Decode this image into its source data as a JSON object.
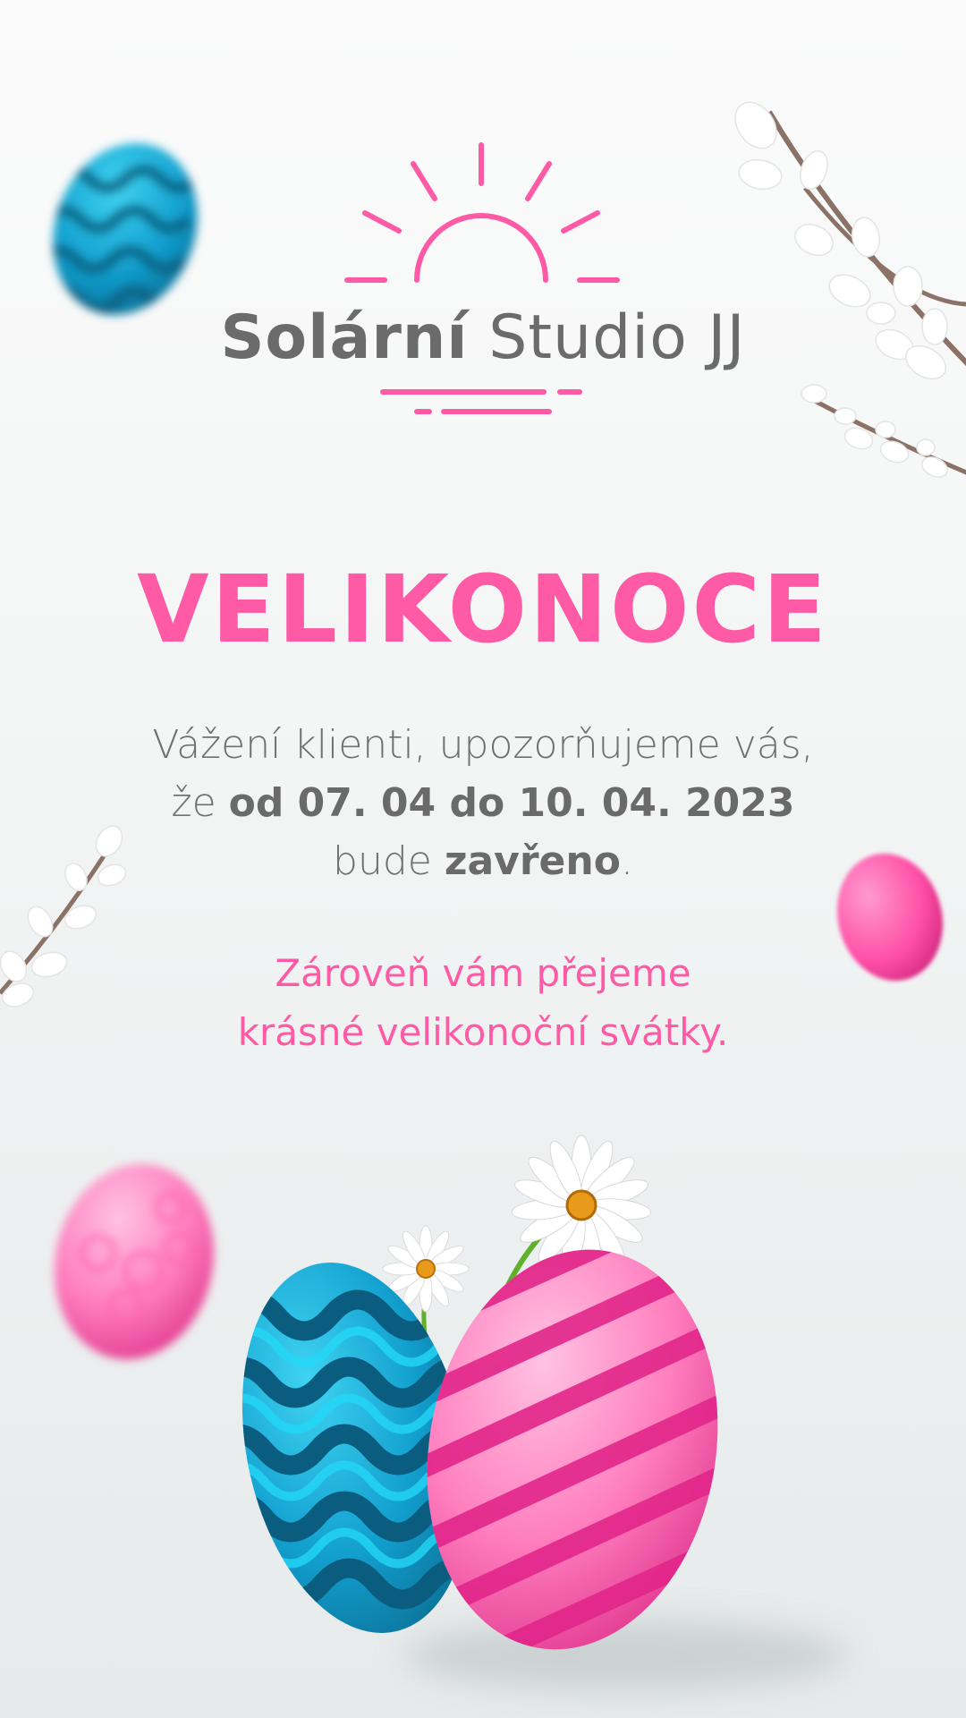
{
  "brand": {
    "name_bold": "Solární",
    "name_regular": "Studio JJ",
    "color": "#ff5aa5"
  },
  "headline": "VELIKONOCE",
  "notice": {
    "line1": "Vážení klienti, upozorňujeme vás,",
    "line2_prefix": "že ",
    "line2_dates": "od 07. 04 do 10. 04. 2023",
    "line3_prefix": "bude ",
    "line3_status": "zavřeno",
    "line3_suffix": "."
  },
  "wishes": {
    "line1": "Zároveň vám přejeme",
    "line2": "krásné velikonoční svátky."
  },
  "colors": {
    "accent": "#ff5aa5",
    "text": "#707070",
    "egg_blue": "#12a9d6",
    "egg_pink": "#ff4fa6"
  },
  "decorations": [
    "blue-egg-icon",
    "pink-egg-icon",
    "pussy-willow-icon",
    "daisy-icon"
  ]
}
